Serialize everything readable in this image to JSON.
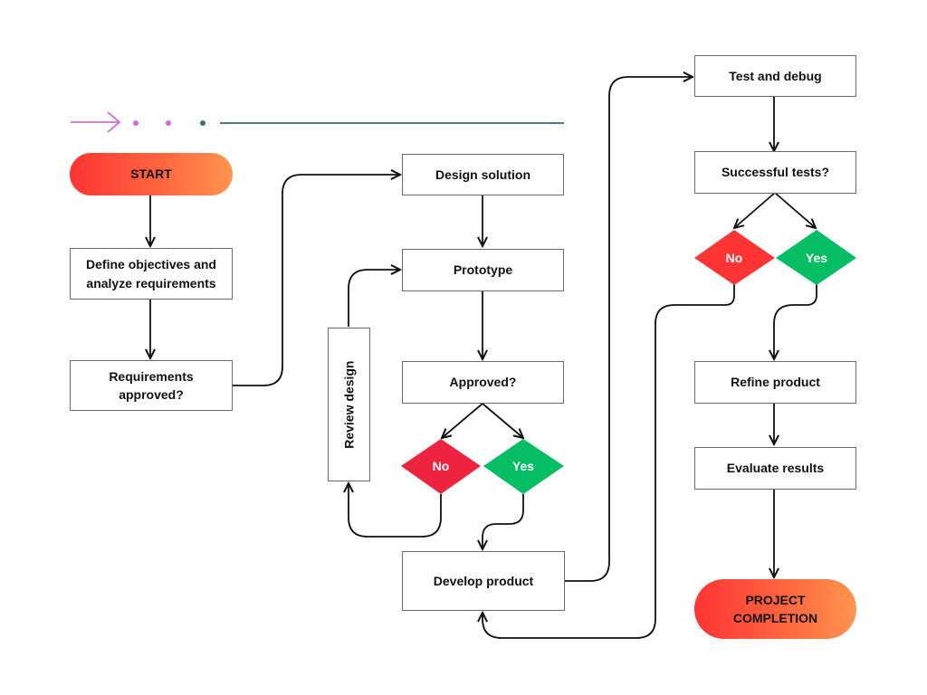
{
  "diagram": {
    "type": "flowchart",
    "header_decoration": {
      "arrow_color": "#d46ad6",
      "dot_colors": [
        "#d46ad6",
        "#d46ad6",
        "#3f6f7a"
      ],
      "line_color": "#4a7a82"
    },
    "colors": {
      "terminal_start": "#ff3434",
      "terminal_end": "#ff944e",
      "no": "#ee2340",
      "no_right": "#ff3535",
      "yes": "#05bd63",
      "stroke": "#111111",
      "box_border": "#6b6b6b"
    },
    "nodes": {
      "start": "START",
      "define": "Define objectives and analyze requirements",
      "req_approved": "Requirements approved?",
      "design": "Design solution",
      "prototype": "Prototype",
      "approved": "Approved?",
      "no1": "No",
      "yes1": "Yes",
      "review": "Review design",
      "develop": "Develop product",
      "test": "Test and debug",
      "successful": "Successful tests?",
      "no2": "No",
      "yes2": "Yes",
      "refine": "Refine product",
      "evaluate": "Evaluate results",
      "completion": "PROJECT COMPLETION"
    },
    "edges": [
      {
        "from": "start",
        "to": "define"
      },
      {
        "from": "define",
        "to": "req_approved"
      },
      {
        "from": "req_approved",
        "to": "design"
      },
      {
        "from": "design",
        "to": "prototype"
      },
      {
        "from": "prototype",
        "to": "approved"
      },
      {
        "from": "approved",
        "to": "no1"
      },
      {
        "from": "approved",
        "to": "yes1"
      },
      {
        "from": "no1",
        "to": "review"
      },
      {
        "from": "review",
        "to": "prototype"
      },
      {
        "from": "yes1",
        "to": "develop"
      },
      {
        "from": "develop",
        "to": "test"
      },
      {
        "from": "test",
        "to": "successful"
      },
      {
        "from": "successful",
        "to": "no2"
      },
      {
        "from": "successful",
        "to": "yes2"
      },
      {
        "from": "no2",
        "to": "develop"
      },
      {
        "from": "yes2",
        "to": "refine"
      },
      {
        "from": "refine",
        "to": "evaluate"
      },
      {
        "from": "evaluate",
        "to": "completion"
      }
    ]
  }
}
